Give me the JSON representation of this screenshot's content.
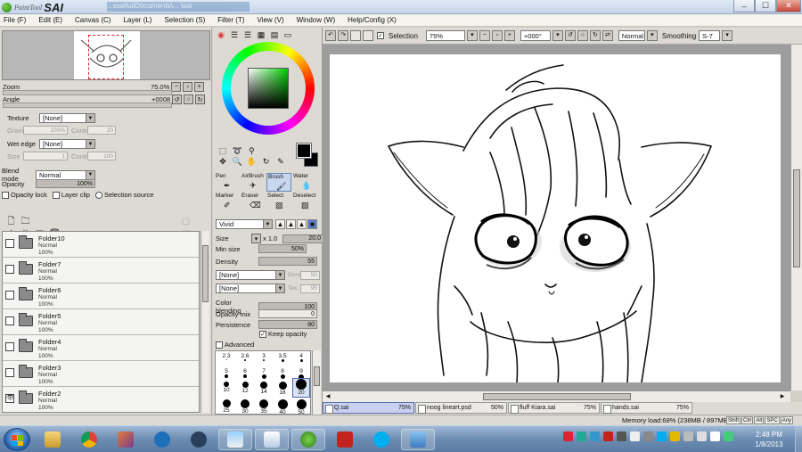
{
  "app": {
    "logo_small": "PaintTool",
    "logo_big": "SAI",
    "path": "...ssafiuilDocuments\\... \\sai"
  },
  "window_controls": {
    "minimize": "–",
    "maximize": "☐",
    "close": "✕"
  },
  "menu": [
    "File (F)",
    "Edit (E)",
    "Canvas (C)",
    "Layer (L)",
    "Selection (S)",
    "Filter (T)",
    "View (V)",
    "Window (W)",
    "Help/Config (X)"
  ],
  "navigator": {
    "zoom_label": "Zoom",
    "zoom_value": "75.0%",
    "angle_label": "Angle",
    "angle_value": "+0008"
  },
  "texture": {
    "texture_label": "Texture",
    "texture_value": "[None]",
    "grain_label": "Grain",
    "grain_value": "100%",
    "contr_label": "Contr",
    "contr_value": "20",
    "wet_label": "Wet edge",
    "wet_value": "[None]",
    "size_label": "Size",
    "size_value": "1",
    "contr2_label": "Contr",
    "contr2_value": "100"
  },
  "blend": {
    "blend_label": "Blend mode",
    "blend_value": "Normal",
    "opacity_label": "Opacity",
    "opacity_value": "100%",
    "opacity_lock": "Opacity lock",
    "layer_clip": "Layer clip",
    "selection_source": "Selection source"
  },
  "layers": [
    {
      "name": "Folder10",
      "mode": "Normal",
      "opacity": "100%",
      "visible": false
    },
    {
      "name": "Folder7",
      "mode": "Normal",
      "opacity": "100%",
      "visible": false
    },
    {
      "name": "Folder6",
      "mode": "Normal",
      "opacity": "100%",
      "visible": false
    },
    {
      "name": "Folder5",
      "mode": "Normal",
      "opacity": "100%",
      "visible": false
    },
    {
      "name": "Folder4",
      "mode": "Normal",
      "opacity": "100%",
      "visible": false
    },
    {
      "name": "Folder3",
      "mode": "Normal",
      "opacity": "100%",
      "visible": false
    },
    {
      "name": "Folder2",
      "mode": "Normal",
      "opacity": "100%",
      "visible": true
    }
  ],
  "tools": {
    "brushes": [
      {
        "label": "Pen",
        "icon": "pen-icon"
      },
      {
        "label": "AirBrush",
        "icon": "airbrush-icon"
      },
      {
        "label": "Brush",
        "icon": "brush-icon"
      },
      {
        "label": "Water",
        "icon": "water-icon"
      },
      {
        "label": "Marker",
        "icon": "marker-icon"
      },
      {
        "label": "Eraser",
        "icon": "eraser-icon"
      },
      {
        "label": "Select",
        "icon": "select-icon"
      },
      {
        "label": "Deselect",
        "icon": "deselect-icon"
      }
    ],
    "selected_brush": "Brush",
    "shape_value": "Vivid",
    "size_label": "Size",
    "size_mult": "x 1.0",
    "size_value": "20.0",
    "minsize_label": "Min size",
    "minsize_value": "50%",
    "density_label": "Density",
    "density_value": "55",
    "tex1_value": "[None]",
    "tex1_label": "Dens",
    "tex1_num": "50",
    "tex2_value": "[None]",
    "tex2_label": "Tex.",
    "tex2_num": "95",
    "colorblend_label": "Color blending",
    "colorblend_value": "100",
    "opacitymix_label": "Opacity mix",
    "opacitymix_value": "0",
    "persistence_label": "Persistence",
    "persistence_value": "80",
    "keep_opacity": "Keep opacity",
    "advanced": "Advanced"
  },
  "brush_sizes": {
    "row1": [
      "2.3",
      "2.6",
      "3",
      "3.5",
      "4"
    ],
    "row2": [
      "5",
      "6",
      "7",
      "8",
      "9"
    ],
    "row3": [
      "10",
      "12",
      "14",
      "16",
      "20"
    ],
    "row4": [
      "25",
      "30",
      "35",
      "40",
      "50"
    ]
  },
  "canvas_toolbar": {
    "selection_label": "Selection",
    "zoom_value": "75%",
    "angle_value": "+000°",
    "mode_value": "Normal",
    "smoothing_label": "Smoothing",
    "smoothing_value": "S-7"
  },
  "doc_tabs": [
    {
      "name": "Q.sai",
      "pct": "75%",
      "active": true
    },
    {
      "name": "noog lineart.psd",
      "pct": "50%",
      "active": false
    },
    {
      "name": "fluff Kiara.sai",
      "pct": "75%",
      "active": false
    },
    {
      "name": "hands.sai",
      "pct": "75%",
      "active": false
    }
  ],
  "status": {
    "memory": "Memory load:68% (238MB / 897MB)",
    "keys": [
      "Shift",
      "Ctrl",
      "Alt",
      "SPC",
      "Any"
    ]
  },
  "taskbar": {
    "time": "2:48 PM",
    "date": "1/8/2013"
  },
  "colors": {
    "fg": "#000000",
    "bg": "#000000",
    "accent": "#5a7dc8"
  }
}
